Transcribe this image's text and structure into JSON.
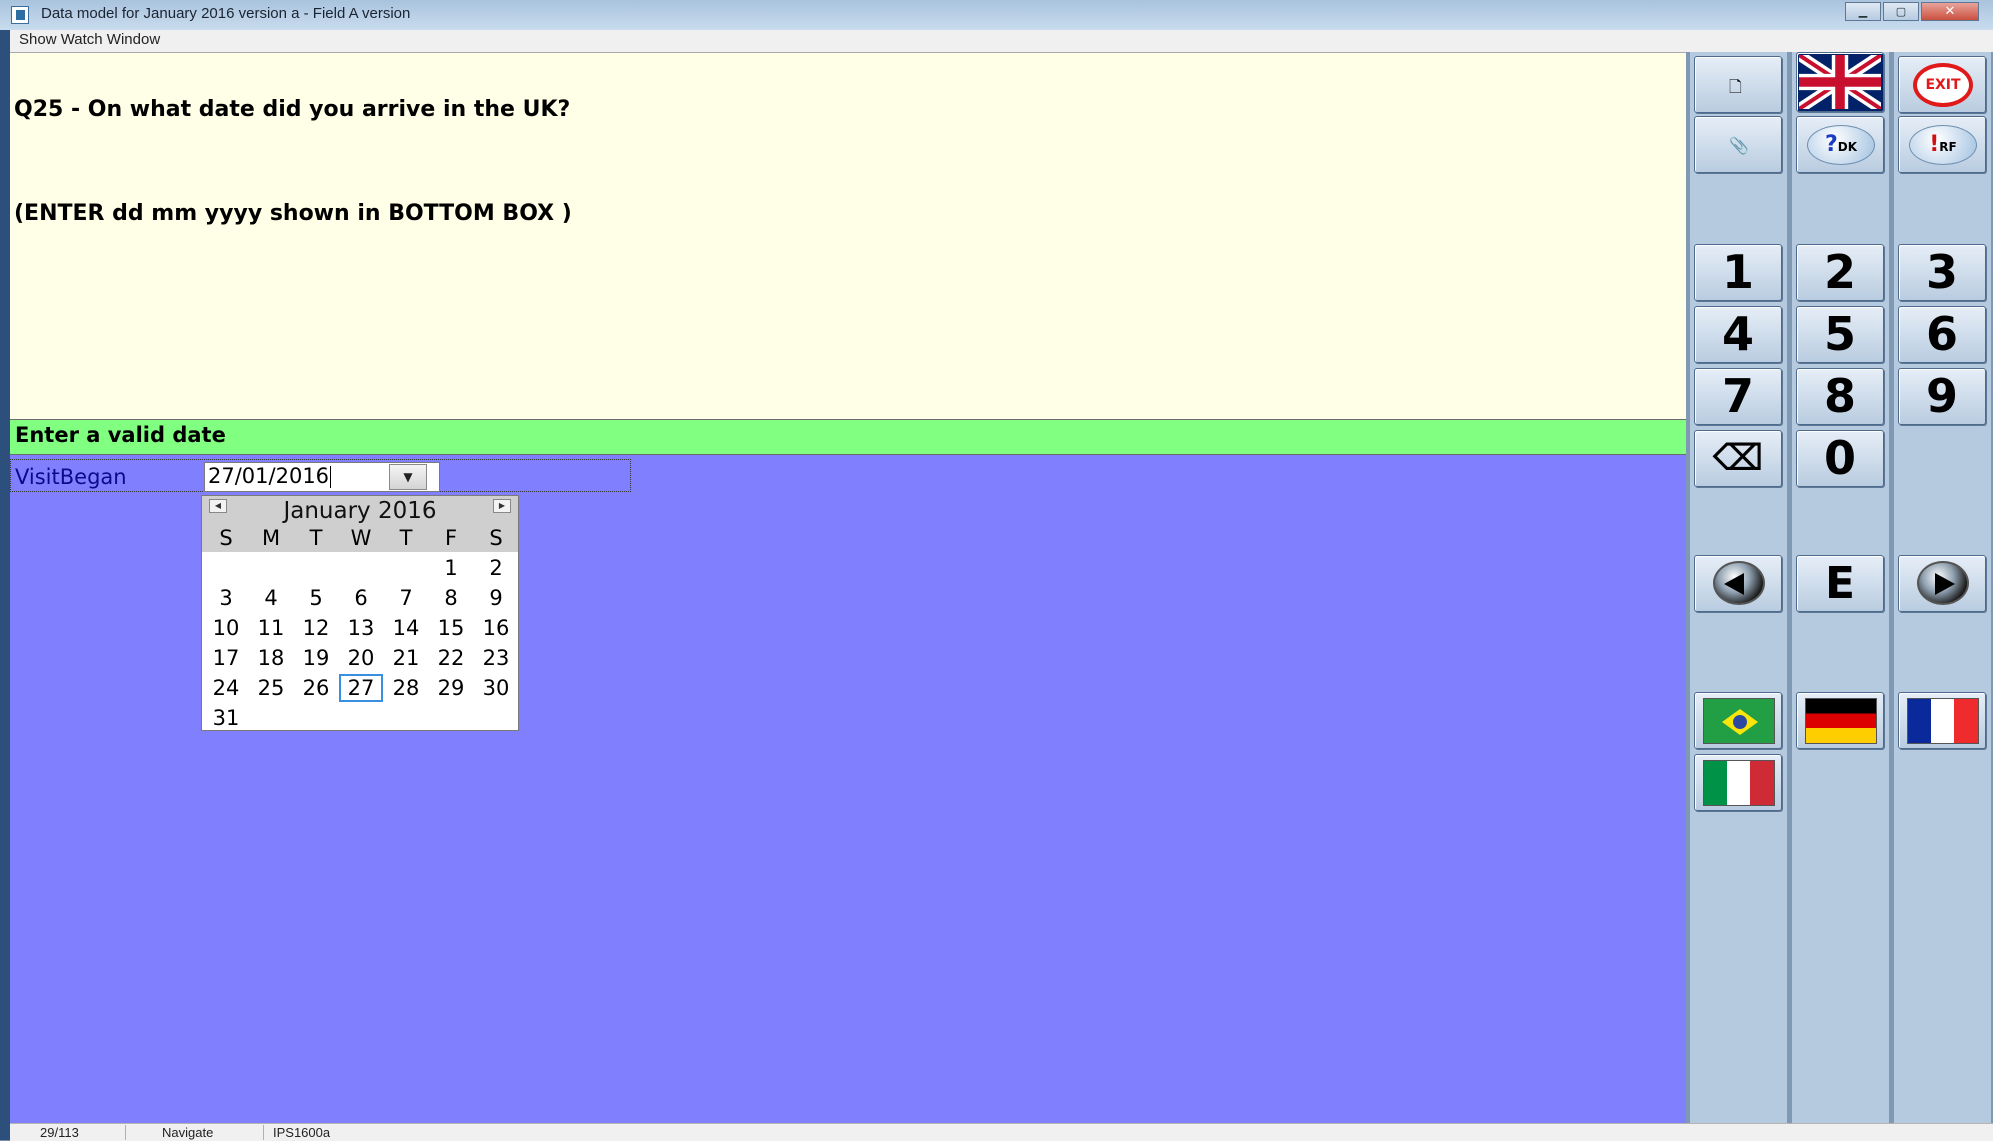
{
  "window": {
    "title": "Data model for January 2016 version a - Field A version",
    "minimize": "▁",
    "maximize": "▢",
    "close": "✕"
  },
  "menu": {
    "item": "Show Watch Window"
  },
  "question": {
    "line1": "Q25 - On what date did you arrive in the UK?",
    "line2": "(ENTER dd mm yyyy shown in BOTTOM BOX )"
  },
  "validation": {
    "message": "Enter a valid date"
  },
  "field": {
    "label": "VisitBegan",
    "value": "27/01/2016"
  },
  "calendar": {
    "month_label": "January 2016",
    "weekdays": [
      "S",
      "M",
      "T",
      "W",
      "T",
      "F",
      "S"
    ],
    "weeks": [
      [
        "",
        "",
        "",
        "",
        "",
        "1",
        "2"
      ],
      [
        "3",
        "4",
        "5",
        "6",
        "7",
        "8",
        "9"
      ],
      [
        "10",
        "11",
        "12",
        "13",
        "14",
        "15",
        "16"
      ],
      [
        "17",
        "18",
        "19",
        "20",
        "21",
        "22",
        "23"
      ],
      [
        "24",
        "25",
        "26",
        "27",
        "28",
        "29",
        "30"
      ],
      [
        "31",
        "",
        "",
        "",
        "",
        "",
        ""
      ]
    ],
    "selected_day": "27"
  },
  "sidebar": {
    "top_buttons": {
      "new_page_icon": "page-icon",
      "attachment_icon": "paperclip-icon",
      "dk": {
        "mark": "?",
        "sub": "DK"
      },
      "rf": {
        "mark": "!",
        "sub": "RF"
      },
      "exit": "EXIT"
    },
    "keypad": [
      "1",
      "2",
      "3",
      "4",
      "5",
      "6",
      "7",
      "8",
      "9",
      "0"
    ],
    "backspace": "⌫",
    "enter": "E",
    "flags": [
      "uk-flag",
      "brazil-flag",
      "germany-flag",
      "france-flag",
      "italy-flag"
    ]
  },
  "status": {
    "position": "29/113",
    "mode": "Navigate",
    "field_name": "IPS1600a"
  }
}
